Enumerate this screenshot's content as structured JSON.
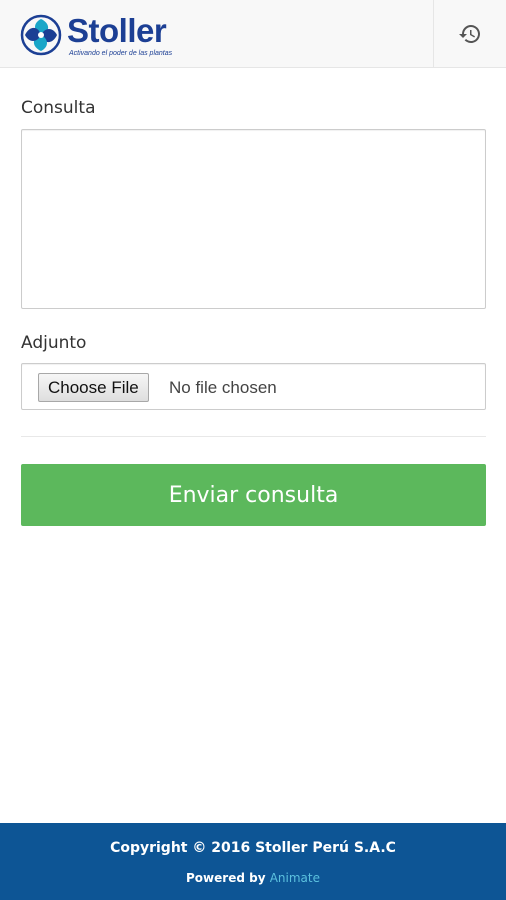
{
  "header": {
    "logo": {
      "name": "Stoller",
      "tagline": "Activando el poder de las plantas",
      "brand_color": "#1c3f94",
      "accent_color": "#19a6c8"
    },
    "history_icon": "history-icon"
  },
  "form": {
    "consulta_label": "Consulta",
    "consulta_value": "",
    "adjunto_label": "Adjunto",
    "choose_file_label": "Choose File",
    "file_status": "No file chosen",
    "submit_label": "Enviar consulta",
    "submit_color": "#5cb85c"
  },
  "footer": {
    "copyright": "Copyright © 2016 Stoller Perú S.A.C",
    "powered_prefix": "Powered by",
    "powered_link": "Animate",
    "background_color": "#0d5595"
  }
}
